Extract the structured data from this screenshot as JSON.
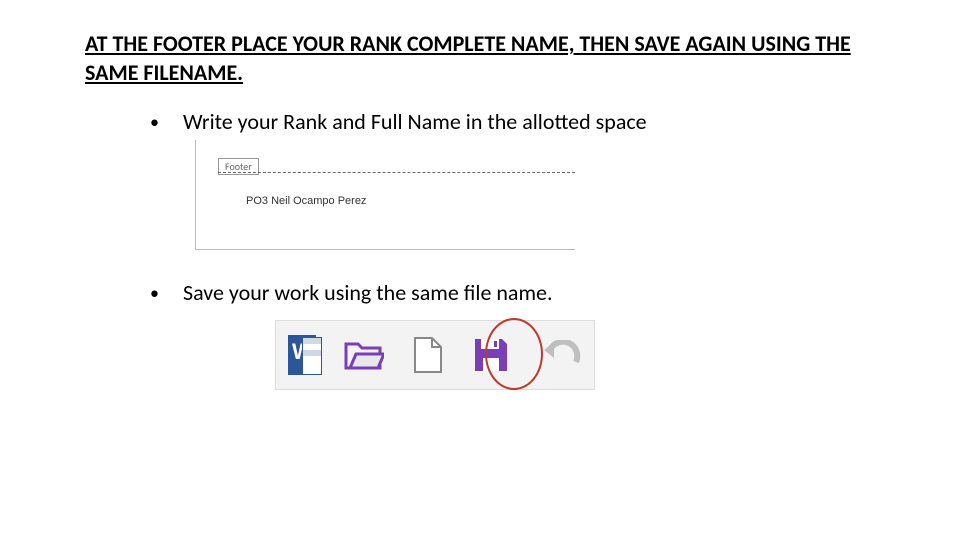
{
  "heading": "AT THE FOOTER PLACE YOUR RANK COMPLETE NAME, THEN SAVE AGAIN USING THE SAME FILENAME.",
  "bullet1": "Write your Rank and Full Name in the allotted space",
  "bullet2": "Save your work using the same file name.",
  "footer": {
    "tab_label": "Footer",
    "example_text": "PO3 Neil Ocampo Perez"
  },
  "toolbar": {
    "word_label": "W",
    "icons": [
      "word-app",
      "open-folder",
      "new-document",
      "save",
      "undo"
    ]
  }
}
